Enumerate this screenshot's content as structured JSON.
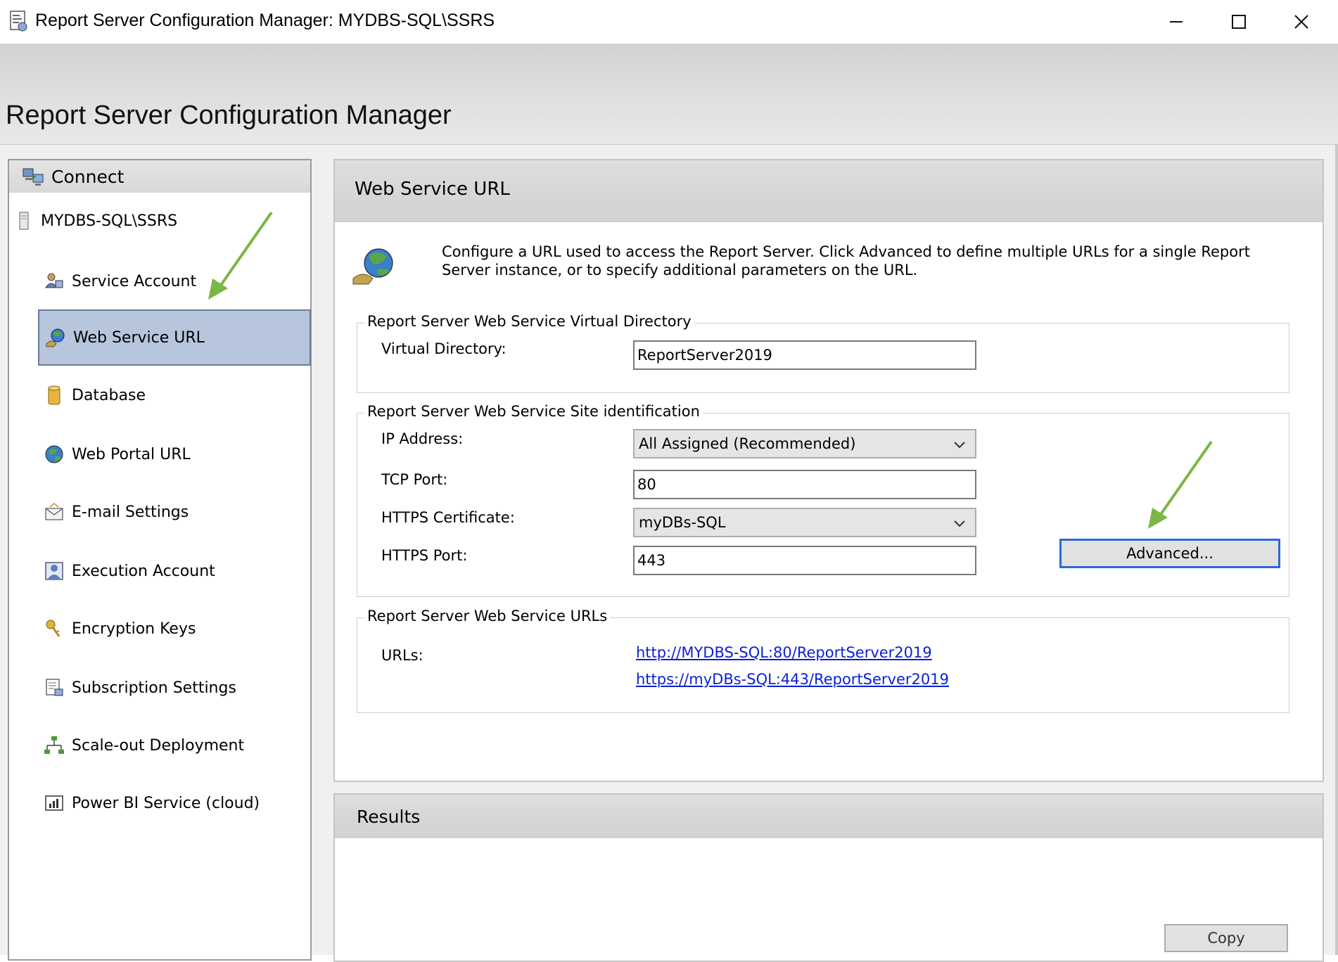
{
  "window": {
    "title": "Report Server Configuration Manager: MYDBS-SQL\\SSRS",
    "controls": {
      "minimize": "minimize-icon",
      "maximize": "maximize-icon",
      "close": "close-icon"
    }
  },
  "header": {
    "title": "Report Server Configuration Manager"
  },
  "sidebar": {
    "connect_label": "Connect",
    "server_label": "MYDBS-SQL\\SSRS",
    "items": [
      {
        "label": "Service Account",
        "icon": "service-account-icon"
      },
      {
        "label": "Web Service URL",
        "icon": "web-service-icon",
        "selected": true
      },
      {
        "label": "Database",
        "icon": "database-icon"
      },
      {
        "label": "Web Portal URL",
        "icon": "globe-icon"
      },
      {
        "label": "E-mail Settings",
        "icon": "email-icon"
      },
      {
        "label": "Execution Account",
        "icon": "execution-account-icon"
      },
      {
        "label": "Encryption Keys",
        "icon": "keys-icon"
      },
      {
        "label": "Subscription Settings",
        "icon": "subscription-icon"
      },
      {
        "label": "Scale-out Deployment",
        "icon": "scale-out-icon"
      },
      {
        "label": "Power BI Service (cloud)",
        "icon": "power-bi-icon"
      }
    ]
  },
  "main": {
    "heading": "Web Service URL",
    "intro": "Configure a URL used to access the Report Server.  Click Advanced to define multiple URLs for a single Report Server instance, or to specify additional parameters on the URL.",
    "virtual_directory": {
      "legend": "Report Server Web Service Virtual Directory",
      "label": "Virtual Directory:",
      "value": "ReportServer2019"
    },
    "site_identification": {
      "legend": "Report Server Web Service Site identification",
      "ip_label": "IP Address:",
      "ip_value": "All Assigned (Recommended)",
      "tcp_label": "TCP Port:",
      "tcp_value": "80",
      "cert_label": "HTTPS Certificate:",
      "cert_value": "myDBs-SQL",
      "https_label": "HTTPS Port:",
      "https_value": "443",
      "advanced_label": "Advanced..."
    },
    "urls": {
      "legend": "Report Server Web Service URLs",
      "label": "URLs:",
      "links": [
        "http://MYDBS-SQL:80/ReportServer2019",
        "https://myDBs-SQL:443/ReportServer2019"
      ]
    }
  },
  "results": {
    "heading": "Results",
    "copy_label": "Copy"
  },
  "colors": {
    "selected_bg": "#b7c5dd",
    "link": "#0b1fd6",
    "annotation_arrow": "#7ab648",
    "focus_border": "#2b6ad6"
  }
}
